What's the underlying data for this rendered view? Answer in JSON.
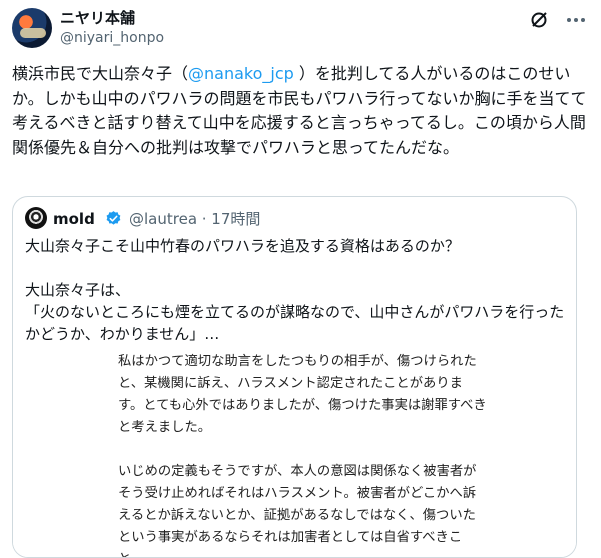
{
  "post": {
    "display_name": "ニヤリ本舗",
    "handle": "@niyari_honpo",
    "icons": [
      "avatar",
      "grok-icon",
      "more-icon"
    ],
    "text_before_mention": "横浜市民で大山奈々子（",
    "mention": "@nanako_jcp",
    "text_after_mention": " ）を批判してる人がいるのはこのせいか。しかも山中のパワハラの問題を市民もパワハラ行ってないか胸に手を当てて考えるべきと話すり替えて山中を応援すると言っちゃってるし。この頃から人間関係優先＆自分への批判は攻撃でパワハラと思ってたんだな。"
  },
  "quote": {
    "display_name": "mold",
    "handle_time": "@lautrea · 17時間",
    "text": "大山奈々子こそ山中竹春のパワハラを追及する資格はあるのか？\n\n大山奈々子は、\n「火のないところにも煙を立てるのが謀略なので、山中さんがパワハラを行ったかどうか、わかりません」…",
    "embedded_image_text": "私はかつて適切な助言をしたつもりの相手が、傷つけられたと、某機関に訴え、ハラスメント認定されたことがあります。とても心外ではありましたが、傷つけた事実は謝罪すべきと考えました。\n\nいじめの定義もそうですが、本人の意図は関係なく被害者がそう受け止めればそれはハラスメント。被害者がどこかへ訴えるとか訴えないとか、証拠があるなしではなく、傷ついたという事実があるならそれは加害者としては自省すべきこと。"
  },
  "colors": {
    "text": "#0f1419",
    "secondary": "#536471",
    "accent": "#1d9bf0",
    "border": "#cfd9de"
  }
}
